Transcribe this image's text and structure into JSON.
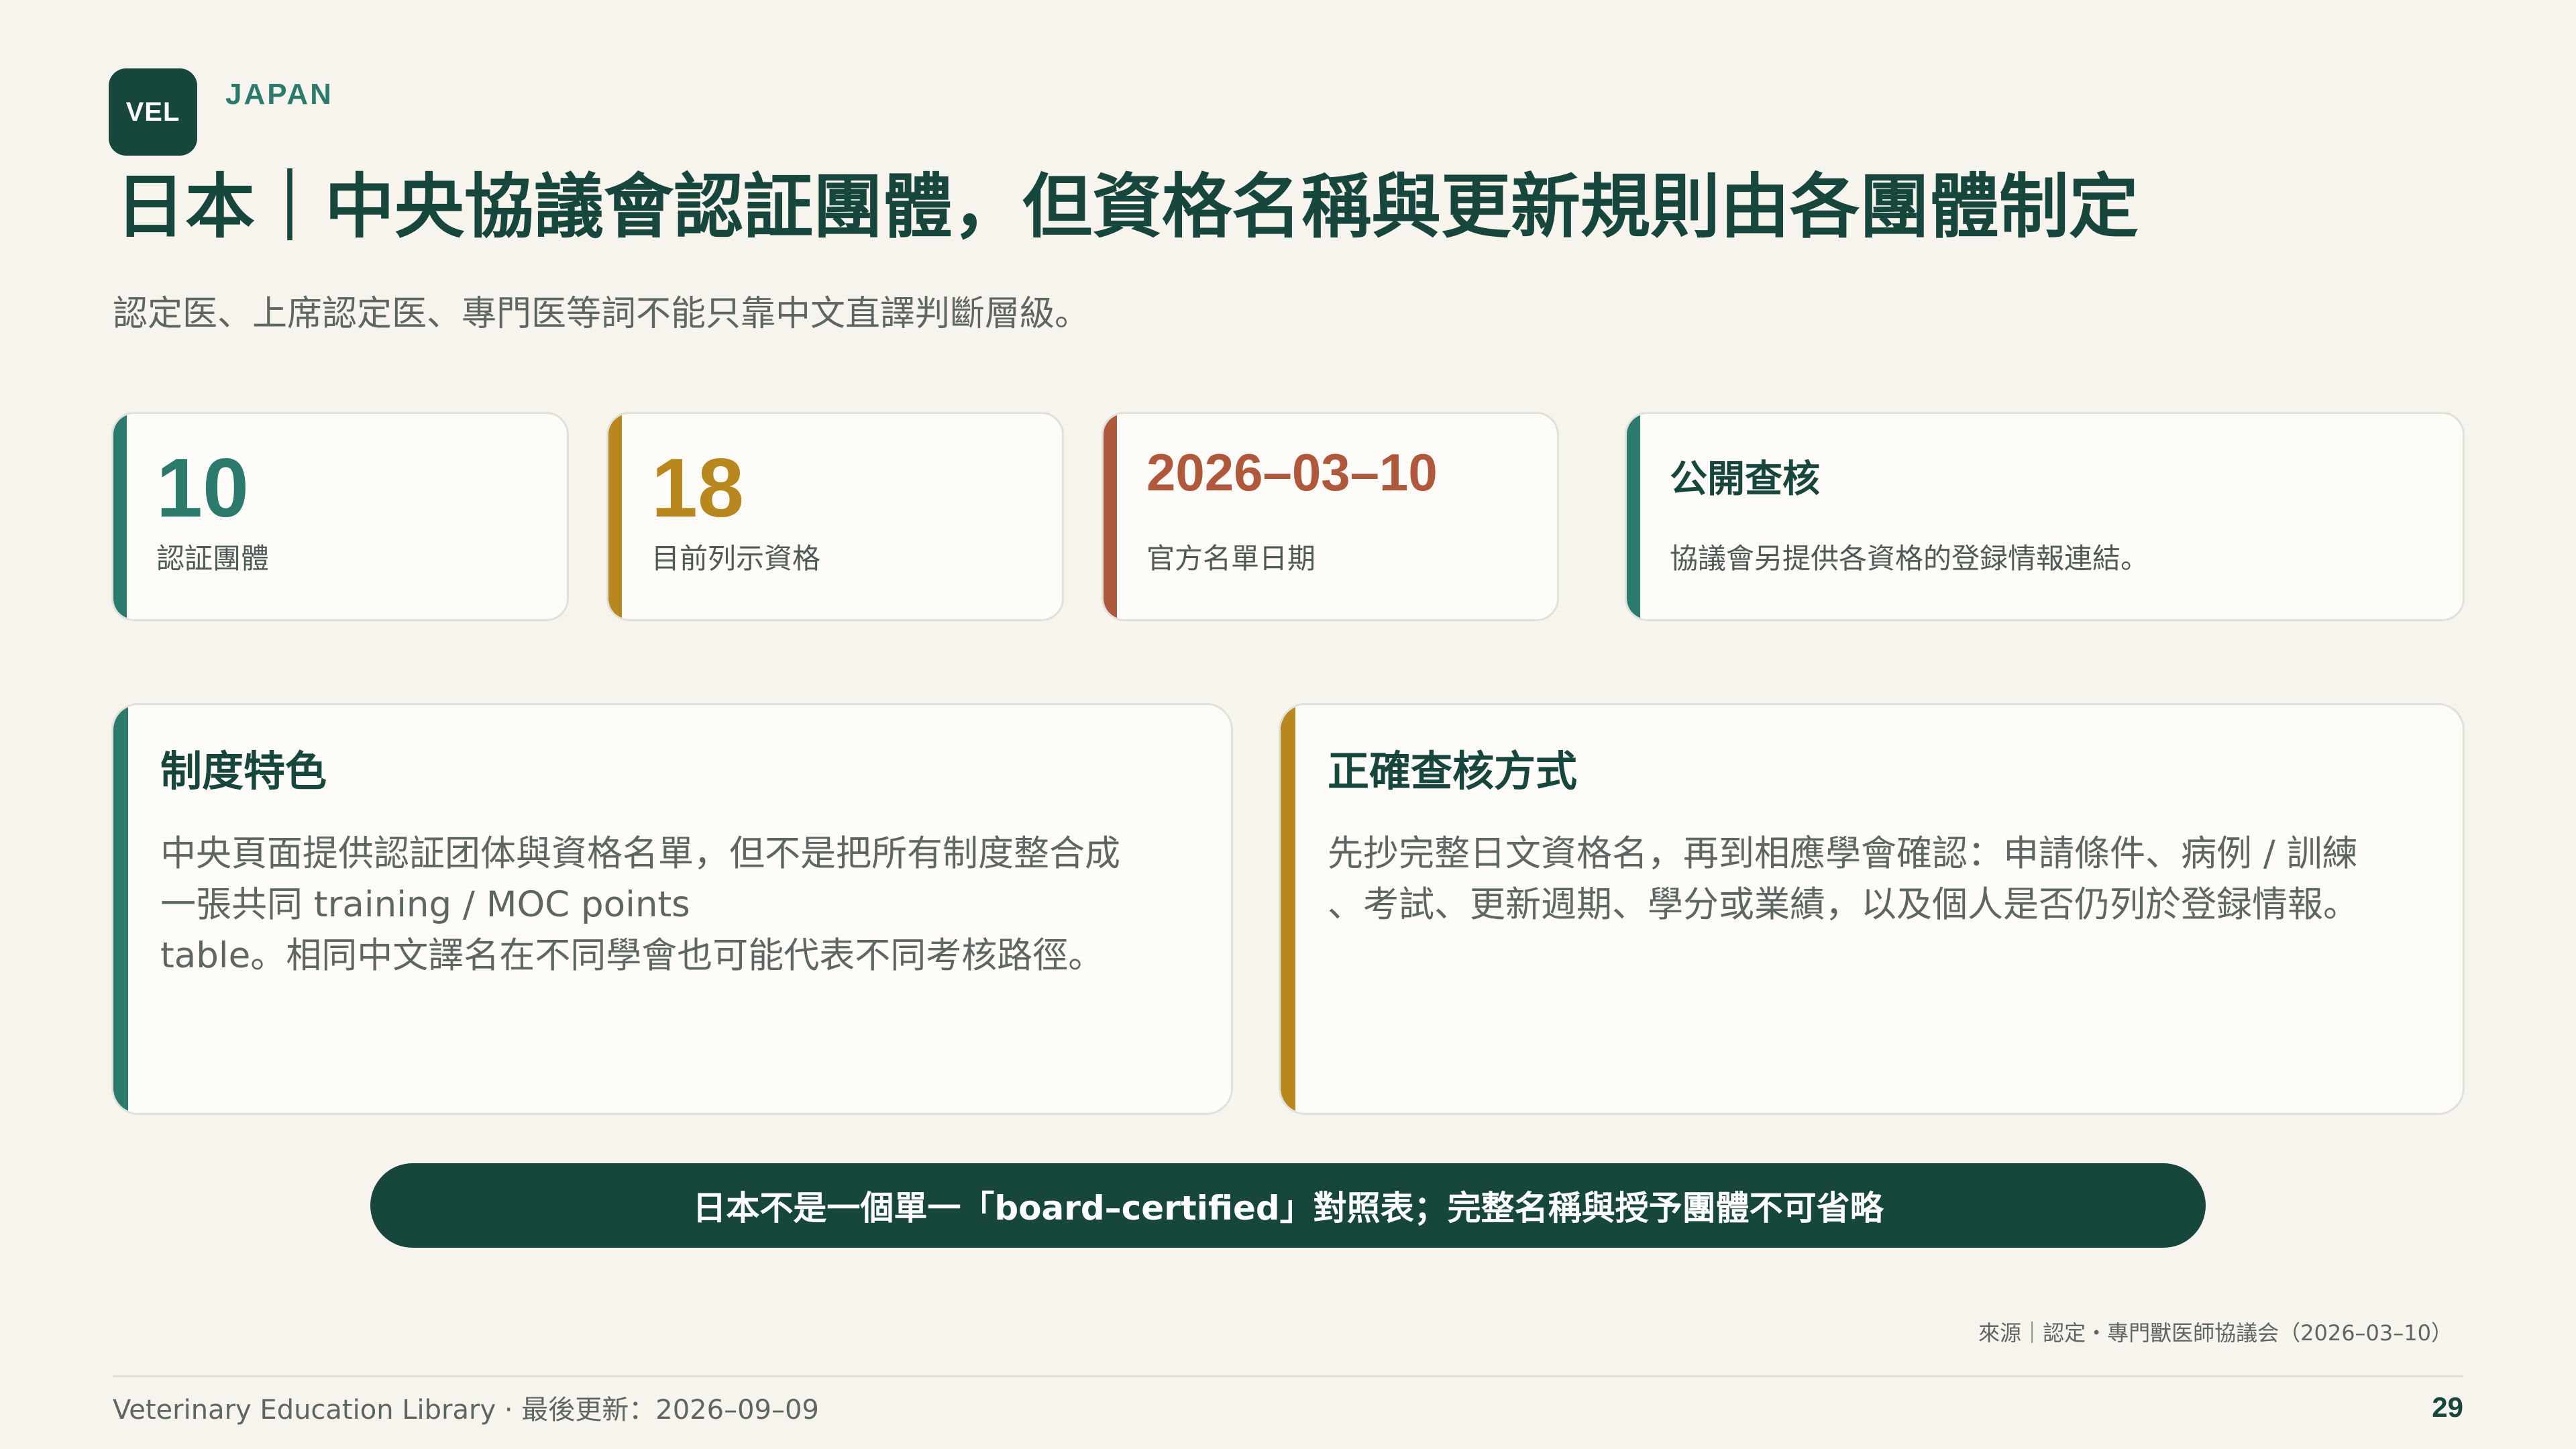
{
  "header": {
    "logo_text": "VEL",
    "region": "JAPAN",
    "title": "日本｜中央協議會認証團體，但資格名稱與更新規則由各團體制定",
    "subtitle": "認定医、上席認定医、專門医等詞不能只靠中文直譯判斷層級。"
  },
  "stats": [
    {
      "value": "10",
      "label": "認証團體",
      "color": "#2c7a6c"
    },
    {
      "value": "18",
      "label": "目前列示資格",
      "color": "#b8881e"
    },
    {
      "value": "2026–03–10",
      "label": "官方名單日期",
      "color": "#b0583c"
    },
    {
      "value": "公開查核",
      "label": "協議會另提供各資格的登録情報連結。",
      "color": "#2c7a6c"
    }
  ],
  "panels": {
    "left": {
      "heading": "制度特色",
      "lines": [
        "中央頁面提供認証团体與資格名單，但不是把所有制度整合成",
        "一張共同 training / MOC points",
        "table。相同中文譯名在不同學會也可能代表不同考核路徑。"
      ],
      "color": "#2c7a6c"
    },
    "right": {
      "heading": "正確查核方式",
      "lines": [
        "先抄完整日文資格名，再到相應學會確認：申請條件、病例 / 訓練",
        "、考試、更新週期、學分或業績，以及個人是否仍列於登録情報。"
      ],
      "color": "#b8881e"
    }
  },
  "banner": {
    "text": "日本不是一個單一「board–certified」對照表；完整名稱與授予團體不可省略"
  },
  "footer": {
    "source": "來源｜認定・專門獸医師協議会（2026–03–10）",
    "library": "Veterinary Education Library · 最後更新：2026–09–09",
    "page_number": "29"
  }
}
